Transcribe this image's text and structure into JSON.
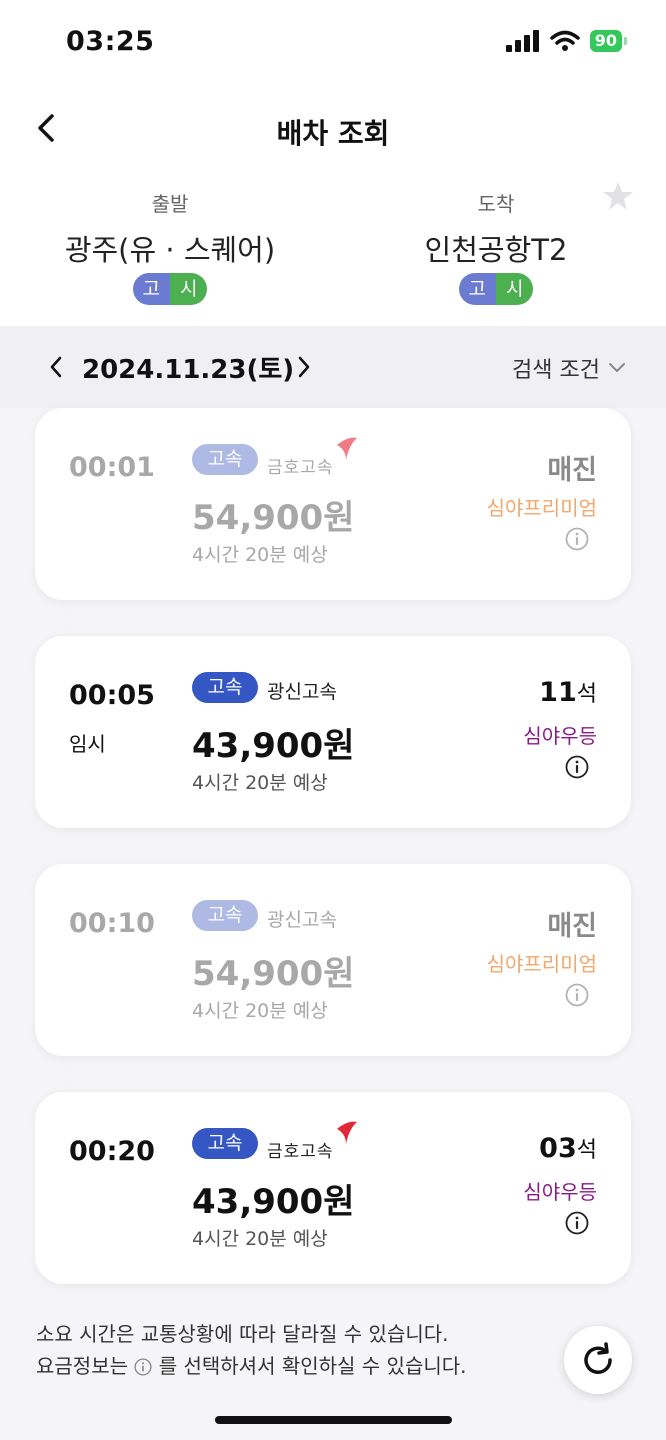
{
  "status_bar": {
    "time": "03:25",
    "battery": "90"
  },
  "header": {
    "title": "배차 조회"
  },
  "route": {
    "departure_label": "출발",
    "departure": "광주(유 · 스퀘어)",
    "arrival_label": "도착",
    "arrival": "인천공항T2",
    "grade_a": "고",
    "grade_b": "시"
  },
  "date_bar": {
    "date": "2024.11.23(토)",
    "search_label": "검색 조건"
  },
  "cards": [
    {
      "time": "00:01",
      "temp": "",
      "tag": "고속",
      "company": "금호고속",
      "price": "54,900원",
      "duration": "4시간 20분 예상",
      "seats": "매진",
      "seat_unit": "",
      "grade": "심야프리미엄",
      "soldout": true
    },
    {
      "time": "00:05",
      "temp": "임시",
      "tag": "고속",
      "company": "광신고속",
      "price": "43,900원",
      "duration": "4시간 20분 예상",
      "seats": "11",
      "seat_unit": "석",
      "grade": "심야우등",
      "soldout": false
    },
    {
      "time": "00:10",
      "temp": "",
      "tag": "고속",
      "company": "광신고속",
      "price": "54,900원",
      "duration": "4시간 20분 예상",
      "seats": "매진",
      "seat_unit": "",
      "grade": "심야프리미엄",
      "soldout": true
    },
    {
      "time": "00:20",
      "temp": "",
      "tag": "고속",
      "company": "금호고속",
      "price": "43,900원",
      "duration": "4시간 20분 예상",
      "seats": "03",
      "seat_unit": "석",
      "grade": "심야우등",
      "soldout": false
    }
  ],
  "footer": {
    "line1": "소요 시간은 교통상황에 따라 달라질 수 있습니다.",
    "line2_before": "요금정보는",
    "line2_after": "를 선택하셔서 확인하실 수 있습니다."
  },
  "colors": {
    "express_tag": "#3557c4",
    "grade_night": "#8b1a89",
    "grade_premium": "#f2a76b",
    "battery": "#34c759"
  },
  "icons": [
    "back-icon",
    "star-icon",
    "chevron-left-icon",
    "chevron-right-icon",
    "chevron-down-icon",
    "info-icon",
    "refresh-icon",
    "signal-icon",
    "wifi-icon"
  ]
}
